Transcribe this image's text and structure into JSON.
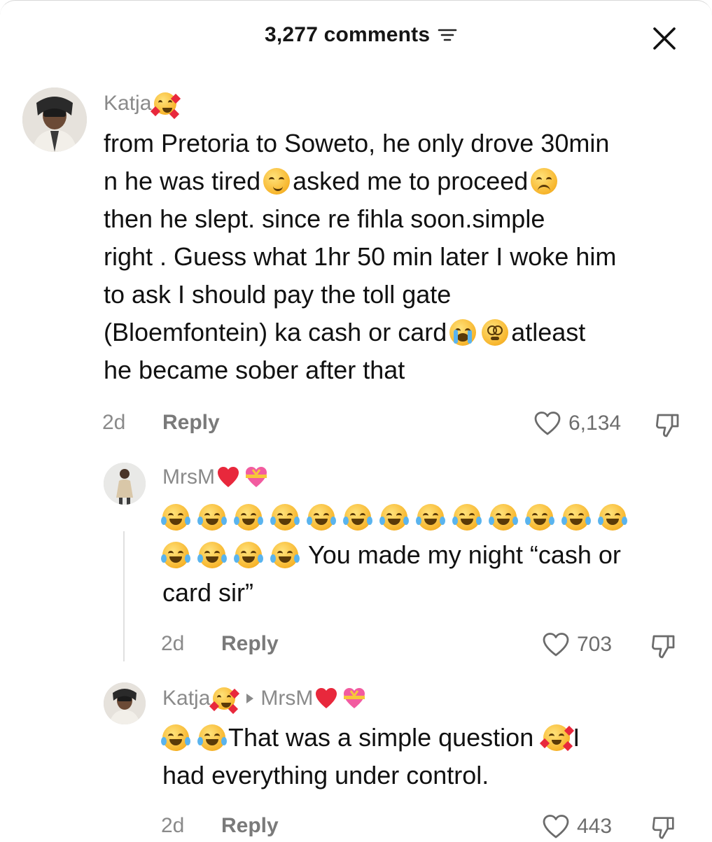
{
  "header": {
    "title": "3,277 comments"
  },
  "comments": [
    {
      "username": "Katja",
      "lines": [
        "from Pretoria to Soweto, he only drove 30min",
        [
          "n he was tired ",
          "asked me to proceed ",
          ""
        ],
        "then he slept. since re fihla soon.simple",
        "right . Guess what 1hr 50 min later I woke him",
        "to ask I should pay the toll gate",
        [
          "(Bloemfontein) ka cash or card ",
          "",
          "atleast"
        ],
        "he became sober after that"
      ],
      "time": "2d",
      "reply_label": "Reply",
      "likes": "6,134"
    },
    {
      "username": "MrsM",
      "line2_text": "You made my night “cash or",
      "line3_text": "card sir”",
      "time": "2d",
      "reply_label": "Reply",
      "likes": "703"
    },
    {
      "username": "Katja",
      "reply_to": "MrsM",
      "line1_text": "That was a simple question",
      "line1_tail": "I",
      "line2_text": "had everything under control.",
      "time": "2d",
      "reply_label": "Reply",
      "likes": "443"
    }
  ],
  "colors": {
    "text": "#111111",
    "meta": "#8a8a8a",
    "heart_red": "#e8283c"
  },
  "icons": [
    "sort-icon",
    "close-icon",
    "heart-outline-icon",
    "dislike-icon",
    "laughing-emoji-icon",
    "smiling-hearts-emoji-icon",
    "red-heart-icon",
    "gift-heart-icon"
  ]
}
